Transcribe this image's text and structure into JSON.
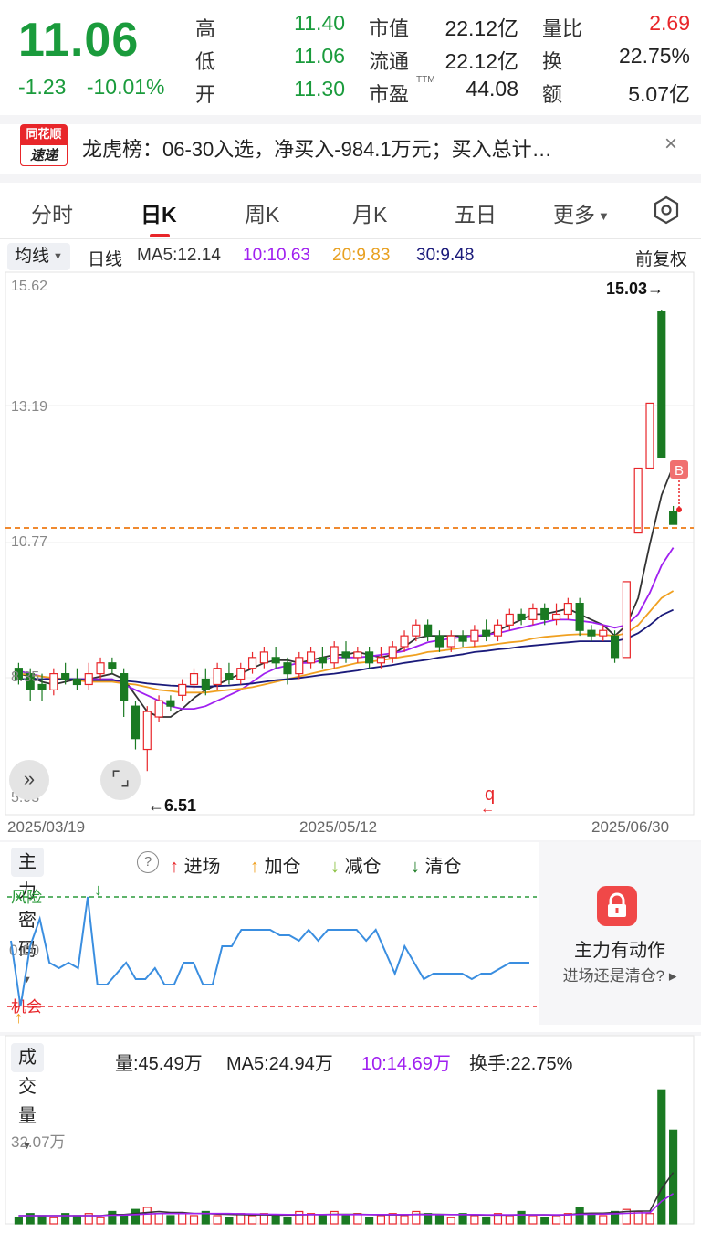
{
  "quote": {
    "price": "11.06",
    "change": "-1.23",
    "change_pct": "-10.01%",
    "rows": [
      {
        "k1": "高",
        "v1": "11.40",
        "k2": "市值",
        "v2": "22.12亿",
        "k3": "量比",
        "v3": "2.69"
      },
      {
        "k1": "低",
        "v1": "11.06",
        "k2": "流通",
        "v2": "22.12亿",
        "k3": "换",
        "v3": "22.75%"
      },
      {
        "k1": "开",
        "v1": "11.30",
        "k2": "市盈",
        "v2": "44.08",
        "k3": "额",
        "v3": "5.07亿"
      }
    ],
    "ttm": "TTM"
  },
  "banner": {
    "logo_top": "同花顺",
    "logo_bottom": "速递",
    "text": "龙虎榜：06-30入选，净买入-984.1万元；买入总计…",
    "close": "×"
  },
  "tabs": [
    "分时",
    "日K",
    "周K",
    "月K",
    "五日",
    "更多"
  ],
  "active_tab": "日K",
  "ma_row": {
    "pill": "均线",
    "period": "日线",
    "ma5": "MA5:12.14",
    "ma10": "10:10.63",
    "ma20": "20:9.83",
    "ma30": "30:9.48",
    "adjust": "前复权"
  },
  "kline": {
    "y_labels": [
      "15.62",
      "13.19",
      "10.77",
      "8.35",
      "5.93"
    ],
    "high_mark": "15.03→",
    "low_mark": "←6.51",
    "b_mark": "B",
    "q_mark": "q",
    "dates": [
      "2025/03/19",
      "2025/05/12",
      "2025/06/30"
    ],
    "colors": {
      "up": "#e8262a",
      "down": "#1a7a22",
      "ma5": "#333333",
      "ma10": "#a020f0",
      "ma20": "#f0a020",
      "ma30": "#1a1a7a"
    }
  },
  "indicator": {
    "pill": "主力密码",
    "help": "?",
    "legend": [
      "进场",
      "加仓",
      "减仓",
      "清仓"
    ],
    "risk": "风险",
    "zero": "0.00",
    "chance": "机会",
    "promo_title": "主力有动作",
    "promo_sub": "进场还是清仓?"
  },
  "volume": {
    "pill": "成交量",
    "vol": "量:45.49万",
    "ma5": "MA5:24.94万",
    "ma10": "10:14.69万",
    "turnover": "换手:22.75%",
    "y_label": "32.07万"
  },
  "chart_data": [
    {
      "type": "candlestick",
      "title": "",
      "ylim": [
        5.93,
        15.62
      ],
      "x_range": [
        "2025/03/19",
        "2025/06/30"
      ],
      "candles": [
        {
          "o": 8.4,
          "c": 8.2,
          "h": 8.5,
          "l": 8.1
        },
        {
          "o": 8.3,
          "c": 8.0,
          "h": 8.4,
          "l": 7.8
        },
        {
          "o": 8.1,
          "c": 8.0,
          "h": 8.3,
          "l": 7.8
        },
        {
          "o": 8.0,
          "c": 8.3,
          "h": 8.4,
          "l": 7.9
        },
        {
          "o": 8.3,
          "c": 8.2,
          "h": 8.5,
          "l": 8.1
        },
        {
          "o": 8.2,
          "c": 8.1,
          "h": 8.4,
          "l": 8.0
        },
        {
          "o": 8.1,
          "c": 8.3,
          "h": 8.5,
          "l": 8.0
        },
        {
          "o": 8.3,
          "c": 8.5,
          "h": 8.6,
          "l": 8.2
        },
        {
          "o": 8.5,
          "c": 8.4,
          "h": 8.6,
          "l": 8.3
        },
        {
          "o": 8.3,
          "c": 7.8,
          "h": 8.4,
          "l": 7.5
        },
        {
          "o": 7.7,
          "c": 7.1,
          "h": 7.8,
          "l": 6.9
        },
        {
          "o": 6.9,
          "c": 7.6,
          "h": 7.7,
          "l": 6.5
        },
        {
          "o": 7.5,
          "c": 7.8,
          "h": 7.9,
          "l": 7.4
        },
        {
          "o": 7.8,
          "c": 7.7,
          "h": 7.9,
          "l": 7.6
        },
        {
          "o": 7.9,
          "c": 8.1,
          "h": 8.2,
          "l": 7.8
        },
        {
          "o": 8.1,
          "c": 8.3,
          "h": 8.4,
          "l": 8.0
        },
        {
          "o": 8.2,
          "c": 8.0,
          "h": 8.4,
          "l": 7.9
        },
        {
          "o": 8.1,
          "c": 8.4,
          "h": 8.5,
          "l": 8.0
        },
        {
          "o": 8.3,
          "c": 8.2,
          "h": 8.5,
          "l": 8.1
        },
        {
          "o": 8.2,
          "c": 8.4,
          "h": 8.5,
          "l": 8.1
        },
        {
          "o": 8.4,
          "c": 8.6,
          "h": 8.7,
          "l": 8.3
        },
        {
          "o": 8.5,
          "c": 8.7,
          "h": 8.8,
          "l": 8.4
        },
        {
          "o": 8.6,
          "c": 8.5,
          "h": 8.8,
          "l": 8.4
        },
        {
          "o": 8.5,
          "c": 8.3,
          "h": 8.6,
          "l": 8.1
        },
        {
          "o": 8.3,
          "c": 8.6,
          "h": 8.7,
          "l": 8.2
        },
        {
          "o": 8.5,
          "c": 8.7,
          "h": 8.8,
          "l": 8.4
        },
        {
          "o": 8.6,
          "c": 8.5,
          "h": 8.8,
          "l": 8.4
        },
        {
          "o": 8.5,
          "c": 8.8,
          "h": 8.9,
          "l": 8.4
        },
        {
          "o": 8.7,
          "c": 8.6,
          "h": 8.9,
          "l": 8.5
        },
        {
          "o": 8.6,
          "c": 8.7,
          "h": 8.8,
          "l": 8.5
        },
        {
          "o": 8.7,
          "c": 8.5,
          "h": 8.8,
          "l": 8.4
        },
        {
          "o": 8.5,
          "c": 8.6,
          "h": 8.8,
          "l": 8.4
        },
        {
          "o": 8.6,
          "c": 8.8,
          "h": 8.9,
          "l": 8.5
        },
        {
          "o": 8.8,
          "c": 9.0,
          "h": 9.1,
          "l": 8.7
        },
        {
          "o": 9.0,
          "c": 9.2,
          "h": 9.3,
          "l": 8.9
        },
        {
          "o": 9.2,
          "c": 9.0,
          "h": 9.3,
          "l": 8.9
        },
        {
          "o": 9.0,
          "c": 8.8,
          "h": 9.1,
          "l": 8.7
        },
        {
          "o": 8.8,
          "c": 9.0,
          "h": 9.1,
          "l": 8.7
        },
        {
          "o": 9.0,
          "c": 8.9,
          "h": 9.1,
          "l": 8.8
        },
        {
          "o": 8.9,
          "c": 9.1,
          "h": 9.2,
          "l": 8.8
        },
        {
          "o": 9.1,
          "c": 9.0,
          "h": 9.3,
          "l": 8.9
        },
        {
          "o": 9.0,
          "c": 9.2,
          "h": 9.3,
          "l": 8.9
        },
        {
          "o": 9.2,
          "c": 9.4,
          "h": 9.5,
          "l": 9.1
        },
        {
          "o": 9.4,
          "c": 9.3,
          "h": 9.5,
          "l": 9.2
        },
        {
          "o": 9.3,
          "c": 9.5,
          "h": 9.6,
          "l": 9.2
        },
        {
          "o": 9.5,
          "c": 9.3,
          "h": 9.6,
          "l": 9.2
        },
        {
          "o": 9.3,
          "c": 9.4,
          "h": 9.6,
          "l": 9.2
        },
        {
          "o": 9.4,
          "c": 9.6,
          "h": 9.7,
          "l": 9.3
        },
        {
          "o": 9.6,
          "c": 9.1,
          "h": 9.7,
          "l": 9.0
        },
        {
          "o": 9.1,
          "c": 9.0,
          "h": 9.2,
          "l": 8.9
        },
        {
          "o": 9.0,
          "c": 9.1,
          "h": 9.2,
          "l": 8.9
        },
        {
          "o": 9.0,
          "c": 8.6,
          "h": 9.1,
          "l": 8.5
        },
        {
          "o": 8.6,
          "c": 10.0,
          "h": 10.0,
          "l": 8.6
        },
        {
          "o": 10.9,
          "c": 12.1,
          "h": 12.1,
          "l": 10.9
        },
        {
          "o": 12.1,
          "c": 13.3,
          "h": 13.3,
          "l": 12.1
        },
        {
          "o": 15.0,
          "c": 12.3,
          "h": 15.03,
          "l": 12.3
        },
        {
          "o": 11.3,
          "c": 11.06,
          "h": 11.4,
          "l": 11.06
        }
      ],
      "ma_lines": {
        "ma5": [
          8.3,
          8.25,
          8.15,
          8.1,
          8.15,
          8.2,
          8.2,
          8.25,
          8.3,
          8.2,
          7.9,
          7.6,
          7.5,
          7.5,
          7.65,
          7.85,
          8.0,
          8.1,
          8.2,
          8.3,
          8.4,
          8.5,
          8.55,
          8.55,
          8.5,
          8.55,
          8.6,
          8.65,
          8.65,
          8.7,
          8.65,
          8.6,
          8.65,
          8.8,
          8.95,
          9.0,
          9.0,
          9.0,
          9.0,
          9.0,
          9.0,
          9.1,
          9.2,
          9.3,
          9.4,
          9.4,
          9.45,
          9.5,
          9.4,
          9.3,
          9.2,
          9.0,
          9.2,
          9.7,
          10.7,
          11.6,
          12.14
        ],
        "ma10": [
          8.35,
          8.3,
          8.25,
          8.2,
          8.2,
          8.2,
          8.2,
          8.2,
          8.2,
          8.1,
          8.0,
          7.9,
          7.8,
          7.7,
          7.65,
          7.65,
          7.7,
          7.8,
          7.9,
          8.0,
          8.15,
          8.3,
          8.4,
          8.45,
          8.5,
          8.5,
          8.55,
          8.6,
          8.6,
          8.6,
          8.62,
          8.65,
          8.68,
          8.72,
          8.8,
          8.88,
          8.92,
          8.95,
          8.98,
          9.0,
          9.02,
          9.05,
          9.1,
          9.15,
          9.2,
          9.25,
          9.3,
          9.3,
          9.28,
          9.25,
          9.2,
          9.15,
          9.2,
          9.4,
          9.8,
          10.3,
          10.63
        ],
        "ma20": [
          8.3,
          8.28,
          8.25,
          8.22,
          8.2,
          8.18,
          8.15,
          8.15,
          8.15,
          8.12,
          8.1,
          8.05,
          8.0,
          7.98,
          7.95,
          7.95,
          7.95,
          7.98,
          8.0,
          8.02,
          8.05,
          8.1,
          8.15,
          8.2,
          8.25,
          8.3,
          8.35,
          8.4,
          8.45,
          8.5,
          8.52,
          8.55,
          8.58,
          8.62,
          8.65,
          8.7,
          8.72,
          8.75,
          8.78,
          8.8,
          8.82,
          8.85,
          8.88,
          8.9,
          8.95,
          8.98,
          9.0,
          9.02,
          9.03,
          9.03,
          9.02,
          9.0,
          9.05,
          9.2,
          9.45,
          9.7,
          9.83
        ],
        "ma30": [
          8.2,
          8.2,
          8.2,
          8.2,
          8.2,
          8.2,
          8.18,
          8.18,
          8.18,
          8.17,
          8.15,
          8.12,
          8.1,
          8.08,
          8.07,
          8.06,
          8.06,
          8.07,
          8.08,
          8.1,
          8.12,
          8.15,
          8.18,
          8.2,
          8.22,
          8.25,
          8.28,
          8.3,
          8.33,
          8.36,
          8.4,
          8.43,
          8.46,
          8.5,
          8.53,
          8.56,
          8.6,
          8.63,
          8.66,
          8.7,
          8.72,
          8.75,
          8.77,
          8.8,
          8.82,
          8.84,
          8.86,
          8.88,
          8.9,
          8.9,
          8.9,
          8.9,
          8.95,
          9.05,
          9.2,
          9.38,
          9.48
        ]
      }
    },
    {
      "type": "line",
      "title": "主力密码",
      "ylim": [
        -1,
        1
      ],
      "values": [
        0.2,
        -1.0,
        0.1,
        0.6,
        -0.2,
        -0.3,
        -0.2,
        -0.3,
        1.0,
        -0.6,
        -0.6,
        -0.4,
        -0.2,
        -0.5,
        -0.5,
        -0.3,
        -0.6,
        -0.6,
        -0.2,
        -0.2,
        -0.6,
        -0.6,
        0.1,
        0.1,
        0.4,
        0.4,
        0.4,
        0.4,
        0.3,
        0.3,
        0.2,
        0.4,
        0.2,
        0.4,
        0.4,
        0.4,
        0.4,
        0.2,
        0.4,
        0.0,
        -0.4,
        0.1,
        -0.2,
        -0.5,
        -0.4,
        -0.4,
        -0.4,
        -0.4,
        -0.5,
        -0.4,
        -0.4,
        -0.3,
        -0.2,
        -0.2,
        -0.2
      ]
    },
    {
      "type": "bar",
      "title": "成交量",
      "ylabel": "万",
      "values": [
        3,
        5,
        4,
        3,
        5,
        4,
        5,
        3,
        6,
        4,
        7,
        8,
        5,
        4,
        5,
        4,
        6,
        4,
        3,
        5,
        4,
        5,
        4,
        3,
        6,
        5,
        4,
        6,
        4,
        5,
        3,
        4,
        5,
        4,
        6,
        5,
        4,
        3,
        5,
        4,
        3,
        5,
        4,
        6,
        4,
        3,
        4,
        5,
        8,
        5,
        4,
        6,
        7,
        6,
        5,
        65,
        45.49
      ],
      "ma5": [
        4,
        4,
        4,
        4,
        4,
        4,
        4,
        4,
        4.5,
        4.5,
        5,
        5.5,
        6,
        5.5,
        5.5,
        5,
        5,
        4.8,
        4.6,
        4.5,
        4.4,
        4.4,
        4.3,
        4.3,
        4.4,
        4.5,
        4.5,
        4.6,
        4.6,
        4.6,
        4.5,
        4.4,
        4.4,
        4.4,
        4.6,
        4.7,
        4.6,
        4.5,
        4.5,
        4.4,
        4.3,
        4.3,
        4.3,
        4.4,
        4.4,
        4.4,
        4.3,
        4.4,
        5,
        5.2,
        5.2,
        5.5,
        6,
        6.2,
        6.2,
        17,
        24.94
      ],
      "ma10": [
        4,
        4,
        4,
        4,
        4,
        4,
        4,
        4,
        4.2,
        4.3,
        4.5,
        4.8,
        5,
        5,
        5,
        5,
        5,
        5,
        5,
        4.9,
        4.8,
        4.7,
        4.6,
        4.5,
        4.5,
        4.5,
        4.5,
        4.5,
        4.5,
        4.5,
        4.5,
        4.5,
        4.5,
        4.5,
        4.5,
        4.5,
        4.5,
        4.5,
        4.5,
        4.5,
        4.4,
        4.4,
        4.4,
        4.4,
        4.4,
        4.4,
        4.4,
        4.4,
        4.6,
        4.7,
        4.8,
        4.9,
        5.1,
        5.3,
        5.4,
        11,
        14.69
      ]
    }
  ]
}
